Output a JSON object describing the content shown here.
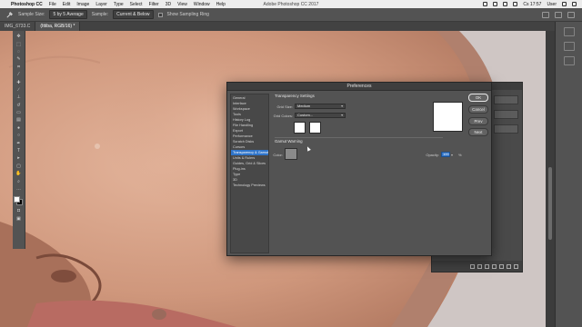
{
  "menubar": {
    "app_name": "Photoshop CC",
    "menus": [
      "File",
      "Edit",
      "Image",
      "Layer",
      "Type",
      "Select",
      "Filter",
      "3D",
      "View",
      "Window",
      "Help"
    ],
    "window_title": "Adobe Photoshop CC 2017",
    "clock": "Cs 17:57",
    "user": "User"
  },
  "options": {
    "sample_size_label": "Sample Size:",
    "sample_size_value": "5 by 5 Average",
    "sample_label": "Sample:",
    "sample_value": "Current & Below",
    "show_ring_label": "Show Sampling Ring"
  },
  "tabs": [
    {
      "label": "IMG_6733.C"
    },
    {
      "label": "(Ittiba, RGB/16) *"
    }
  ],
  "toolbar": {
    "tools": [
      "move",
      "marquee",
      "lasso",
      "quick-select",
      "crop",
      "eyedropper",
      "healing",
      "brush",
      "stamp",
      "history-brush",
      "eraser",
      "gradient",
      "blur",
      "dodge",
      "pen",
      "type",
      "path-select",
      "shape",
      "hand",
      "zoom",
      "more",
      "fg-bg",
      "quick-mask",
      "screen-mode"
    ],
    "foreground_color": "#ffffff",
    "background_color": "#000000"
  },
  "dialog": {
    "title": "Preferences",
    "nav_items": [
      "General",
      "Interface",
      "Workspace",
      "Tools",
      "History Log",
      "File Handling",
      "Export",
      "Performance",
      "Scratch Disks",
      "Cursors",
      "Transparency & Gamut",
      "Units & Rulers",
      "Guides, Grid & Slices",
      "Plug-ins",
      "Type",
      "3D",
      "Technology Previews"
    ],
    "selected_nav": "Transparency & Gamut",
    "transparency": {
      "heading": "Transparency Settings",
      "grid_size_label": "Grid Size:",
      "grid_size_value": "Medium",
      "grid_colors_label": "Grid Colors:",
      "grid_colors_value": "Custom..."
    },
    "gamut": {
      "heading": "Gamut Warning",
      "color_label": "Color:",
      "opacity_label": "Opacity:",
      "opacity_value": "100",
      "opacity_unit": "%"
    },
    "buttons": {
      "ok": "OK",
      "cancel": "Cancel",
      "prev": "Prev",
      "next": "Next"
    }
  },
  "colors": {
    "accent": "#2f74c9",
    "panel": "#535353",
    "dialog_bg": "#535353",
    "gamut_swatch": "#8a8a8a"
  }
}
